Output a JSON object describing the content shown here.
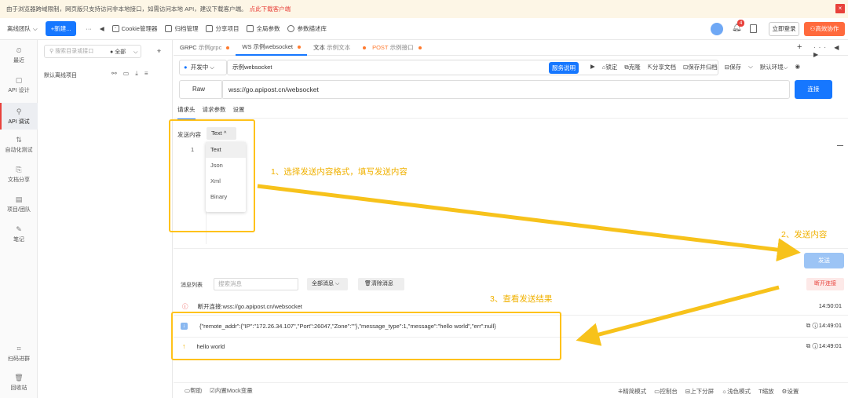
{
  "banner": {
    "text": "由于浏览器跨域限制，网页版只支持访问非本地接口，如需访问本地 API，建议下载客户端。",
    "link": "点此下载客户端",
    "close": "×"
  },
  "topbar": {
    "team": "离线团队",
    "new_btn": "+新建...",
    "more": "···",
    "back": "◀",
    "items": [
      "Cookie管理器",
      "归档管理",
      "分享项目",
      "全局参数",
      "参数描述库"
    ],
    "badge": "4",
    "login": "立即登录",
    "collab": "高效协作"
  },
  "rail": [
    {
      "icon": "⏲",
      "label": "最近"
    },
    {
      "icon": "▢",
      "label": "API 设计"
    },
    {
      "icon": "⚲",
      "label": "API 调试"
    },
    {
      "icon": "⇅",
      "label": "自动化测试"
    },
    {
      "icon": "⎘",
      "label": "文档分享"
    },
    {
      "icon": "▤",
      "label": "项目/团队"
    },
    {
      "icon": "✎",
      "label": "笔记"
    },
    {
      "icon": "⌗",
      "label": "扫码进群"
    },
    {
      "icon": "🗑",
      "label": "回收站"
    }
  ],
  "tree": {
    "search_placeholder": "搜索目录或接口",
    "filter": "全部",
    "root": "默认离线项目"
  },
  "tabs": [
    {
      "method": "GRPC",
      "name": "示例grpc"
    },
    {
      "method": "WS",
      "name": "示例websocket"
    },
    {
      "method": "文本",
      "name": "示例文本"
    },
    {
      "method": "POST",
      "name": "示例接口"
    }
  ],
  "env": {
    "status": "开发中",
    "name": "示例websocket",
    "service_doc": "服务说明",
    "actions": [
      "锁定",
      "克隆",
      "分享文档",
      "保存并归档",
      "保存"
    ],
    "env_select": "默认环境"
  },
  "request": {
    "mode": "Raw",
    "url": "wss://go.apipost.cn/websocket",
    "connect": "连接"
  },
  "subtabs": [
    "请求头",
    "请求参数",
    "设置"
  ],
  "send": {
    "label": "发送内容",
    "format": "Text",
    "line_no": "1",
    "formats": [
      "Text",
      "Json",
      "Xml",
      "Binary"
    ],
    "button": "发送"
  },
  "annotations": [
    "1、选择发送内容格式，填写发送内容",
    "2、发送内容",
    "3、查看发送结果"
  ],
  "messages": {
    "label": "消息列表",
    "search_placeholder": "搜索消息",
    "filter": "全部消息",
    "clear": "清除消息",
    "disconnect": "断开连接",
    "rows": [
      {
        "icon": "ⓘ",
        "text": "断开连接:wss://go.apipost.cn/websocket",
        "time": "14:50:01"
      },
      {
        "icon": "↓",
        "text": "{\"remote_addr\":{\"IP\":\"172.26.34.107\",\"Port\":26047,\"Zone\":\"\"},\"message_type\":1,\"message\":\"hello world\",\"err\":null}",
        "time": "14:49:01"
      },
      {
        "icon": "↑",
        "text": "hello world",
        "time": "14:49:01"
      }
    ]
  },
  "bottombar": {
    "left": [
      "帮助",
      "内置Mock变量"
    ],
    "right": [
      "精简模式",
      "控制台",
      "上下分屏",
      "浅色模式",
      "缩放",
      "设置"
    ]
  },
  "colors": {
    "accent": "#1677ff",
    "brand": "#ff7a2e",
    "annotation": "#ffc21a"
  }
}
